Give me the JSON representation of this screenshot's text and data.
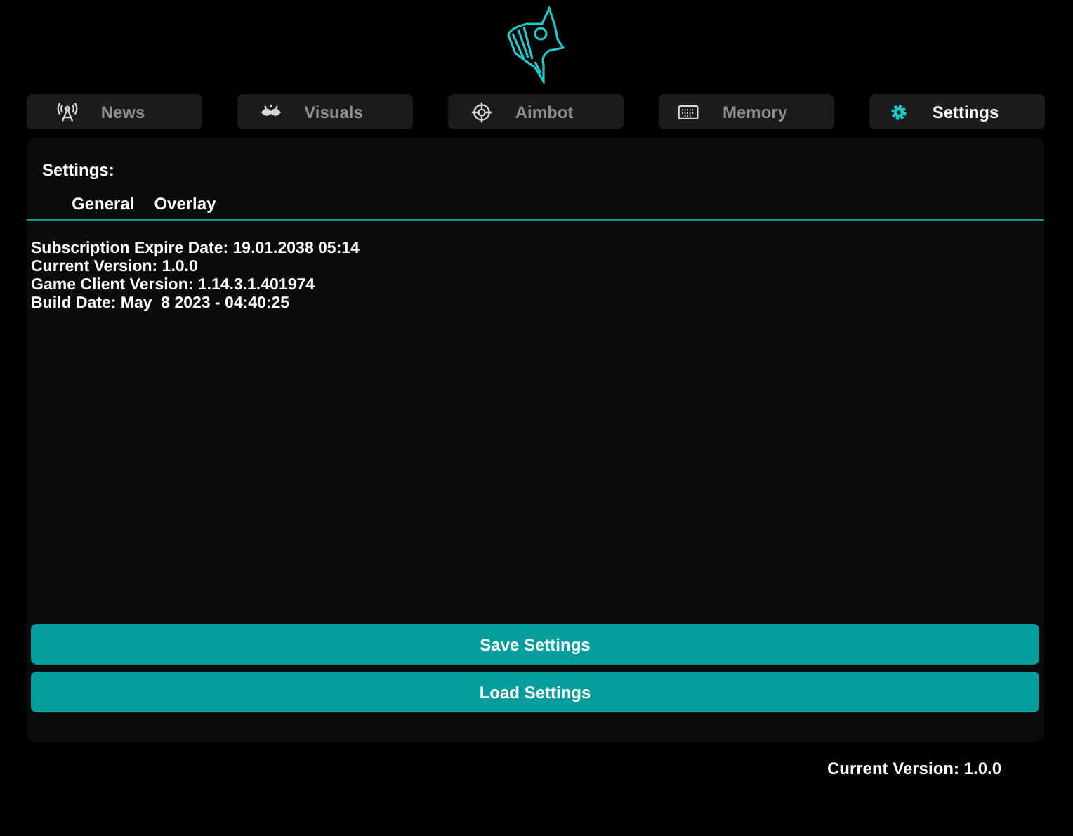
{
  "tabs": [
    {
      "label": "News",
      "selected": false
    },
    {
      "label": "Visuals",
      "selected": false
    },
    {
      "label": "Aimbot",
      "selected": false
    },
    {
      "label": "Memory",
      "selected": false
    },
    {
      "label": "Settings",
      "selected": true
    }
  ],
  "panel": {
    "heading": "Settings:",
    "subtabs": [
      "General",
      "Overlay"
    ],
    "info": [
      "Subscription Expire Date: 19.01.2038 05:14",
      "Current Version: 1.0.0",
      "Game Client Version: 1.14.3.1.401974",
      "Build Date: May  8 2023 - 04:40:25"
    ],
    "buttons": [
      "Save Settings",
      "Load Settings"
    ]
  },
  "footer": "Current Version: 1.0.0"
}
